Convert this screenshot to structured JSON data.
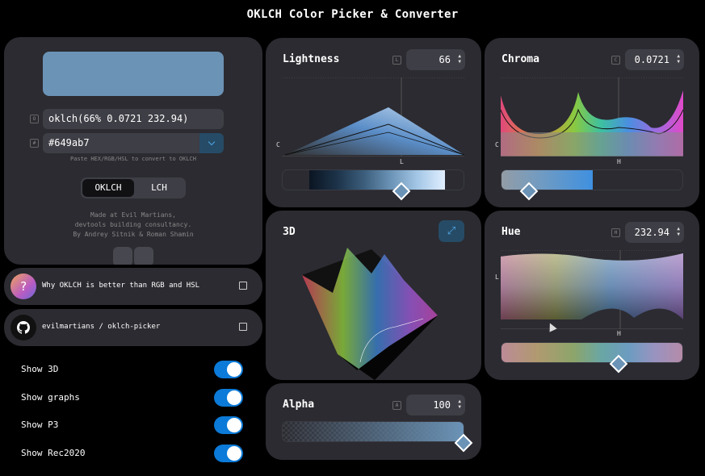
{
  "app": {
    "title": "OKLCH Color Picker & Converter"
  },
  "picker": {
    "color_hex": "#6b93b6",
    "oklch_key": "O",
    "oklch_value": "oklch(66% 0.0721 232.94)",
    "hex_key": "#",
    "hex_value": "#649ab7",
    "hint": "Paste HEX/RGB/HSL to convert to OKLCH",
    "mode_options": [
      "OKLCH",
      "LCH"
    ],
    "mode_selected": "OKLCH",
    "credit_line1": "Made at Evil Martians,",
    "credit_line2": "devtools building consultancy.",
    "credit_line3": "By Andrey Sitnik & Roman Shamin"
  },
  "links": [
    {
      "label": "Why OKLCH is better than RGB and HSL",
      "icon": "question-icon"
    },
    {
      "label": "evilmartians / oklch-picker",
      "icon": "github-icon"
    }
  ],
  "toggles": [
    {
      "label": "Show 3D",
      "on": true
    },
    {
      "label": "Show graphs",
      "on": true
    },
    {
      "label": "Show P3",
      "on": true
    },
    {
      "label": "Show Rec2020",
      "on": true
    }
  ],
  "lightness": {
    "title": "Lightness",
    "key": "L",
    "value": "66",
    "axis_y": "C",
    "axis_x": "L",
    "slider_fraction": 0.66
  },
  "chroma": {
    "title": "Chroma",
    "key": "C",
    "value": "0.0721",
    "axis_y": "C",
    "axis_x": "H",
    "slider_fraction": 0.16
  },
  "hue": {
    "title": "Hue",
    "key": "H",
    "value": "232.94",
    "axis_y": "L",
    "axis_x": "H",
    "slider_fraction": 0.65
  },
  "three_d": {
    "title": "3D"
  },
  "alpha": {
    "title": "Alpha",
    "key": "A",
    "value": "100",
    "slider_fraction": 1.0
  }
}
